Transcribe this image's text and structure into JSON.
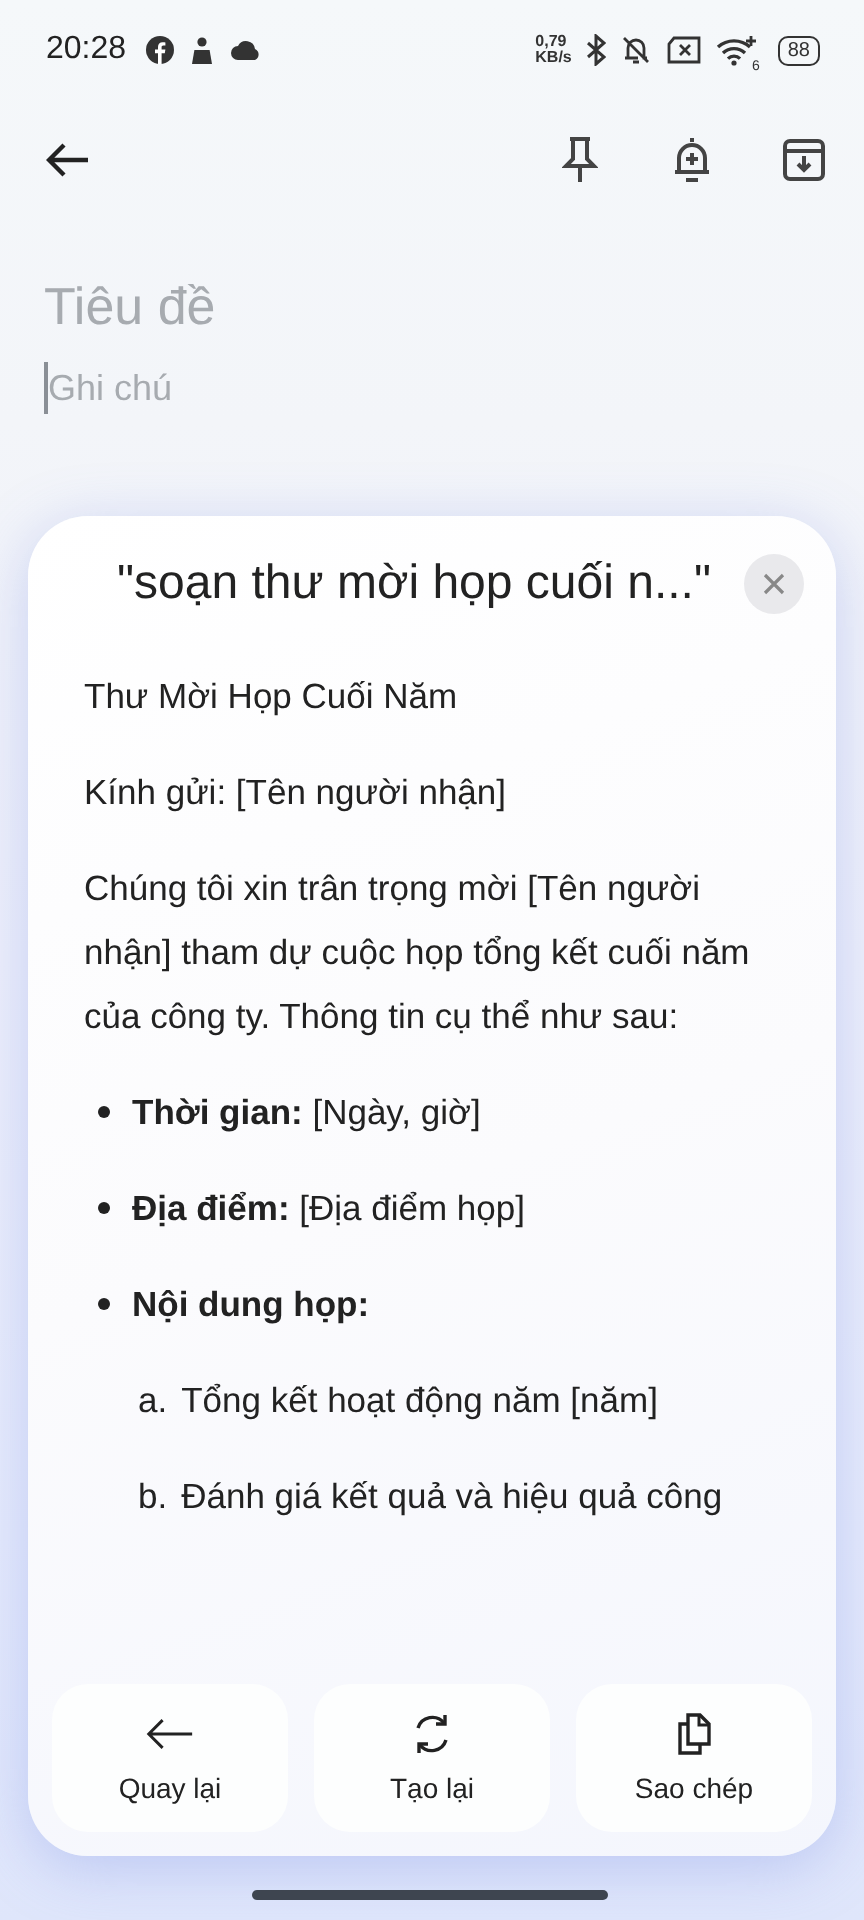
{
  "status_bar": {
    "time": "20:28",
    "speed_value": "0,79",
    "speed_unit": "KB/s",
    "wifi_badge": "6",
    "battery": "88"
  },
  "note": {
    "title_placeholder": "Tiêu đề",
    "body_placeholder": "Ghi chú"
  },
  "ai_sheet": {
    "prompt": "\"soạn thư mời họp cuối n...\"",
    "content": [
      {
        "kind": "paragraph",
        "text": "Thư Mời Họp Cuối Năm"
      },
      {
        "kind": "paragraph",
        "text": "Kính gửi: [Tên người nhận]"
      },
      {
        "kind": "paragraph",
        "text": "Chúng tôi xin trân trọng mời [Tên người nhận] tham dự cuộc họp tổng kết cuối năm của công ty. Thông tin cụ thể như sau:"
      },
      {
        "kind": "bullet",
        "text": "**Thời gian:** [Ngày, giờ]"
      },
      {
        "kind": "bullet",
        "text": "**Địa điểm:** [Địa điểm họp]"
      },
      {
        "kind": "bullet",
        "text": "**Nội dung họp:**",
        "children": [
          {
            "marker": "a.",
            "text": "Tổng kết hoạt động năm [năm]"
          },
          {
            "marker": "b.",
            "text": "Đánh giá kết quả và hiệu quả công"
          }
        ]
      }
    ],
    "actions": [
      {
        "kind": "back",
        "label": "Quay lại"
      },
      {
        "kind": "regenerate",
        "label": "Tạo lại"
      },
      {
        "kind": "copy",
        "label": "Sao chép"
      }
    ]
  }
}
